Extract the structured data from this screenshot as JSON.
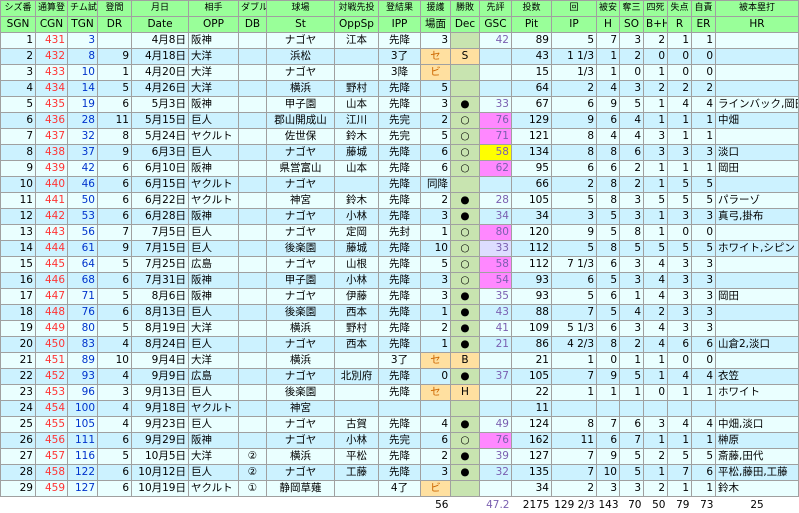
{
  "header1": [
    "シズ番",
    "通算登",
    "チム試",
    "登間",
    "月日",
    "相手",
    "ダブル",
    "球場",
    "対戦先投",
    "登結果",
    "援護",
    "勝敗",
    "先評",
    "投数",
    "回",
    "被安",
    "奪三",
    "四死",
    "失点",
    "自責",
    "被本塁打"
  ],
  "header2": [
    "SGN",
    "CGN",
    "TGN",
    "DR",
    "Date",
    "OPP",
    "DB",
    "St",
    "OppSp",
    "IPP",
    "場面",
    "Dec",
    "GSC",
    "Pit",
    "IP",
    "H",
    "SO",
    "B+H",
    "R",
    "ER",
    "HR"
  ],
  "rows": [
    {
      "sgn": "1",
      "cgn": "431",
      "tgn": "3",
      "dr": "",
      "date": "4月8日",
      "opp": "阪神",
      "db": "",
      "st": "ナゴヤ",
      "oppsp": "江本",
      "ipp": "先降",
      "sup": "3",
      "dec": "",
      "gsc": "42",
      "gscStyle": "",
      "pit": "89",
      "ip": "5",
      "h": "7",
      "so": "3",
      "bh": "2",
      "r": "1",
      "er": "1",
      "hr": ""
    },
    {
      "sgn": "2",
      "cgn": "432",
      "tgn": "8",
      "dr": "9",
      "date": "4月18日",
      "opp": "大洋",
      "db": "",
      "st": "浜松",
      "oppsp": "",
      "ipp": "3了",
      "sup": "セ",
      "dec": "S",
      "gsc": "",
      "gscStyle": "",
      "pit": "43",
      "ip": "1 1/3",
      "h": "1",
      "so": "2",
      "bh": "0",
      "r": "0",
      "er": "0",
      "hr": ""
    },
    {
      "sgn": "3",
      "cgn": "433",
      "tgn": "10",
      "dr": "1",
      "date": "4月20日",
      "opp": "大洋",
      "db": "",
      "st": "ナゴヤ",
      "oppsp": "",
      "ipp": "3降",
      "sup": "ビ",
      "dec": "",
      "gsc": "",
      "gscStyle": "",
      "pit": "15",
      "ip": "1/3",
      "h": "1",
      "so": "0",
      "bh": "1",
      "r": "0",
      "er": "0",
      "hr": ""
    },
    {
      "sgn": "4",
      "cgn": "434",
      "tgn": "14",
      "dr": "5",
      "date": "4月26日",
      "opp": "大洋",
      "db": "",
      "st": "横浜",
      "oppsp": "野村",
      "ipp": "先降",
      "sup": "5",
      "dec": "",
      "gsc": "",
      "gscStyle": "",
      "pit": "64",
      "ip": "2",
      "h": "4",
      "so": "3",
      "bh": "2",
      "r": "2",
      "er": "2",
      "hr": ""
    },
    {
      "sgn": "5",
      "cgn": "435",
      "tgn": "19",
      "dr": "6",
      "date": "5月3日",
      "opp": "阪神",
      "db": "",
      "st": "甲子園",
      "oppsp": "山本",
      "ipp": "先降",
      "sup": "3",
      "dec": "●",
      "gsc": "33",
      "gscStyle": "",
      "pit": "67",
      "ip": "6",
      "h": "9",
      "so": "5",
      "bh": "1",
      "r": "4",
      "er": "4",
      "hr": "ラインバック,岡田"
    },
    {
      "sgn": "6",
      "cgn": "436",
      "tgn": "28",
      "dr": "11",
      "date": "5月15日",
      "opp": "巨人",
      "db": "",
      "st": "郡山開成山",
      "oppsp": "江川",
      "ipp": "先完",
      "sup": "2",
      "dec": "○",
      "gsc": "76",
      "gscStyle": "g-hi",
      "pit": "129",
      "ip": "9",
      "h": "6",
      "so": "4",
      "bh": "1",
      "r": "1",
      "er": "1",
      "hr": "中畑"
    },
    {
      "sgn": "7",
      "cgn": "437",
      "tgn": "32",
      "dr": "8",
      "date": "5月24日",
      "opp": "ヤクルト",
      "db": "",
      "st": "佐世保",
      "oppsp": "鈴木",
      "ipp": "先完",
      "sup": "5",
      "dec": "○",
      "gsc": "71",
      "gscStyle": "g-hi",
      "pit": "121",
      "ip": "8",
      "h": "4",
      "so": "4",
      "bh": "3",
      "r": "1",
      "er": "1",
      "hr": ""
    },
    {
      "sgn": "8",
      "cgn": "438",
      "tgn": "37",
      "dr": "9",
      "date": "6月3日",
      "opp": "巨人",
      "db": "",
      "st": "ナゴヤ",
      "oppsp": "藤城",
      "ipp": "先降",
      "sup": "6",
      "dec": "○",
      "gsc": "58",
      "gscStyle": "g-top",
      "pit": "134",
      "ip": "8",
      "h": "8",
      "so": "6",
      "bh": "3",
      "r": "3",
      "er": "3",
      "hr": "淡口"
    },
    {
      "sgn": "9",
      "cgn": "439",
      "tgn": "42",
      "dr": "6",
      "date": "6月10日",
      "opp": "阪神",
      "db": "",
      "st": "県営富山",
      "oppsp": "山本",
      "ipp": "先降",
      "sup": "6",
      "dec": "○",
      "gsc": "62",
      "gscStyle": "g-hi",
      "pit": "95",
      "ip": "6",
      "h": "6",
      "so": "2",
      "bh": "1",
      "r": "1",
      "er": "1",
      "hr": "岡田"
    },
    {
      "sgn": "10",
      "cgn": "440",
      "tgn": "46",
      "dr": "6",
      "date": "6月15日",
      "opp": "ヤクルト",
      "db": "",
      "st": "ナゴヤ",
      "oppsp": "",
      "ipp": "先降",
      "sup": "同降",
      "dec": "",
      "gsc": "",
      "gscStyle": "",
      "pit": "66",
      "ip": "2",
      "h": "8",
      "so": "2",
      "bh": "1",
      "r": "5",
      "er": "5",
      "hr": ""
    },
    {
      "sgn": "11",
      "cgn": "441",
      "tgn": "50",
      "dr": "6",
      "date": "6月22日",
      "opp": "ヤクルト",
      "db": "",
      "st": "神宮",
      "oppsp": "鈴木",
      "ipp": "先降",
      "sup": "2",
      "dec": "●",
      "gsc": "28",
      "gscStyle": "",
      "pit": "105",
      "ip": "5",
      "h": "8",
      "so": "3",
      "bh": "5",
      "r": "5",
      "er": "5",
      "hr": "パラーゾ"
    },
    {
      "sgn": "12",
      "cgn": "442",
      "tgn": "53",
      "dr": "6",
      "date": "6月28日",
      "opp": "阪神",
      "db": "",
      "st": "ナゴヤ",
      "oppsp": "小林",
      "ipp": "先降",
      "sup": "3",
      "dec": "●",
      "gsc": "34",
      "gscStyle": "",
      "pit": "34",
      "ip": "3",
      "h": "5",
      "so": "3",
      "bh": "1",
      "r": "3",
      "er": "3",
      "hr": "真弓,掛布"
    },
    {
      "sgn": "13",
      "cgn": "443",
      "tgn": "56",
      "dr": "7",
      "date": "7月5日",
      "opp": "巨人",
      "db": "",
      "st": "ナゴヤ",
      "oppsp": "定岡",
      "ipp": "先封",
      "sup": "1",
      "dec": "○",
      "gsc": "80",
      "gscStyle": "g-hi",
      "pit": "120",
      "ip": "9",
      "h": "5",
      "so": "8",
      "bh": "1",
      "r": "0",
      "er": "0",
      "hr": ""
    },
    {
      "sgn": "14",
      "cgn": "444",
      "tgn": "61",
      "dr": "9",
      "date": "7月15日",
      "opp": "巨人",
      "db": "",
      "st": "後楽園",
      "oppsp": "藤城",
      "ipp": "先降",
      "sup": "10",
      "dec": "○",
      "gsc": "33",
      "gscStyle": "g-lo",
      "pit": "112",
      "ip": "5",
      "h": "8",
      "so": "5",
      "bh": "5",
      "r": "5",
      "er": "5",
      "hr": "ホワイト,シピン"
    },
    {
      "sgn": "15",
      "cgn": "445",
      "tgn": "64",
      "dr": "5",
      "date": "7月25日",
      "opp": "広島",
      "db": "",
      "st": "ナゴヤ",
      "oppsp": "山根",
      "ipp": "先降",
      "sup": "5",
      "dec": "○",
      "gsc": "58",
      "gscStyle": "g-hi",
      "pit": "112",
      "ip": "7 1/3",
      "h": "6",
      "so": "3",
      "bh": "4",
      "r": "3",
      "er": "3",
      "hr": ""
    },
    {
      "sgn": "16",
      "cgn": "446",
      "tgn": "68",
      "dr": "6",
      "date": "7月31日",
      "opp": "阪神",
      "db": "",
      "st": "甲子園",
      "oppsp": "小林",
      "ipp": "先降",
      "sup": "3",
      "dec": "○",
      "gsc": "54",
      "gscStyle": "g-hi",
      "pit": "93",
      "ip": "6",
      "h": "5",
      "so": "3",
      "bh": "4",
      "r": "3",
      "er": "3",
      "hr": ""
    },
    {
      "sgn": "17",
      "cgn": "447",
      "tgn": "71",
      "dr": "5",
      "date": "8月6日",
      "opp": "阪神",
      "db": "",
      "st": "ナゴヤ",
      "oppsp": "伊藤",
      "ipp": "先降",
      "sup": "3",
      "dec": "●",
      "gsc": "35",
      "gscStyle": "",
      "pit": "93",
      "ip": "5",
      "h": "6",
      "so": "1",
      "bh": "4",
      "r": "3",
      "er": "3",
      "hr": "岡田"
    },
    {
      "sgn": "18",
      "cgn": "448",
      "tgn": "76",
      "dr": "6",
      "date": "8月13日",
      "opp": "巨人",
      "db": "",
      "st": "後楽園",
      "oppsp": "西本",
      "ipp": "先降",
      "sup": "1",
      "dec": "●",
      "gsc": "43",
      "gscStyle": "",
      "pit": "88",
      "ip": "7",
      "h": "5",
      "so": "4",
      "bh": "2",
      "r": "3",
      "er": "3",
      "hr": ""
    },
    {
      "sgn": "19",
      "cgn": "449",
      "tgn": "80",
      "dr": "5",
      "date": "8月19日",
      "opp": "大洋",
      "db": "",
      "st": "横浜",
      "oppsp": "野村",
      "ipp": "先降",
      "sup": "2",
      "dec": "●",
      "gsc": "41",
      "gscStyle": "",
      "pit": "109",
      "ip": "5 1/3",
      "h": "6",
      "so": "3",
      "bh": "4",
      "r": "3",
      "er": "3",
      "hr": ""
    },
    {
      "sgn": "20",
      "cgn": "450",
      "tgn": "83",
      "dr": "4",
      "date": "8月24日",
      "opp": "巨人",
      "db": "",
      "st": "ナゴヤ",
      "oppsp": "西本",
      "ipp": "先降",
      "sup": "1",
      "dec": "●",
      "gsc": "21",
      "gscStyle": "",
      "pit": "86",
      "ip": "4 2/3",
      "h": "8",
      "so": "2",
      "bh": "4",
      "r": "6",
      "er": "6",
      "hr": "山倉2,淡口"
    },
    {
      "sgn": "21",
      "cgn": "451",
      "tgn": "89",
      "dr": "10",
      "date": "9月4日",
      "opp": "大洋",
      "db": "",
      "st": "横浜",
      "oppsp": "",
      "ipp": "3了",
      "sup": "セ",
      "dec": "B",
      "gsc": "",
      "gscStyle": "",
      "pit": "21",
      "ip": "1",
      "h": "0",
      "so": "1",
      "bh": "1",
      "r": "0",
      "er": "0",
      "hr": ""
    },
    {
      "sgn": "22",
      "cgn": "452",
      "tgn": "93",
      "dr": "4",
      "date": "9月9日",
      "opp": "広島",
      "db": "",
      "st": "ナゴヤ",
      "oppsp": "北別府",
      "ipp": "先降",
      "sup": "0",
      "dec": "●",
      "gsc": "37",
      "gscStyle": "",
      "pit": "105",
      "ip": "7",
      "h": "9",
      "so": "5",
      "bh": "1",
      "r": "4",
      "er": "4",
      "hr": "衣笠"
    },
    {
      "sgn": "23",
      "cgn": "453",
      "tgn": "96",
      "dr": "3",
      "date": "9月13日",
      "opp": "巨人",
      "db": "",
      "st": "後楽園",
      "oppsp": "",
      "ipp": "先降",
      "sup": "セ",
      "dec": "H",
      "gsc": "",
      "gscStyle": "",
      "pit": "22",
      "ip": "1",
      "h": "1",
      "so": "1",
      "bh": "0",
      "r": "1",
      "er": "1",
      "hr": "ホワイト"
    },
    {
      "sgn": "24",
      "cgn": "454",
      "tgn": "100",
      "dr": "4",
      "date": "9月18日",
      "opp": "ヤクルト",
      "db": "",
      "st": "神宮",
      "oppsp": "",
      "ipp": "",
      "sup": "",
      "dec": "",
      "gsc": "",
      "gscStyle": "",
      "pit": "11",
      "ip": "",
      "h": "",
      "so": "",
      "bh": "",
      "r": "",
      "er": "",
      "hr": ""
    },
    {
      "sgn": "25",
      "cgn": "455",
      "tgn": "105",
      "dr": "4",
      "date": "9月23日",
      "opp": "巨人",
      "db": "",
      "st": "ナゴヤ",
      "oppsp": "古賀",
      "ipp": "先降",
      "sup": "4",
      "dec": "●",
      "gsc": "49",
      "gscStyle": "",
      "pit": "124",
      "ip": "8",
      "h": "7",
      "so": "6",
      "bh": "3",
      "r": "4",
      "er": "4",
      "hr": "中畑,淡口"
    },
    {
      "sgn": "26",
      "cgn": "456",
      "tgn": "111",
      "dr": "6",
      "date": "9月29日",
      "opp": "阪神",
      "db": "",
      "st": "ナゴヤ",
      "oppsp": "小林",
      "ipp": "先完",
      "sup": "6",
      "dec": "○",
      "gsc": "76",
      "gscStyle": "g-hi",
      "pit": "162",
      "ip": "11",
      "h": "6",
      "so": "7",
      "bh": "1",
      "r": "1",
      "er": "1",
      "hr": "榊原"
    },
    {
      "sgn": "27",
      "cgn": "457",
      "tgn": "116",
      "dr": "5",
      "date": "10月5日",
      "opp": "大洋",
      "db": "②",
      "st": "横浜",
      "oppsp": "平松",
      "ipp": "先降",
      "sup": "2",
      "dec": "●",
      "gsc": "39",
      "gscStyle": "",
      "pit": "127",
      "ip": "7",
      "h": "9",
      "so": "5",
      "bh": "2",
      "r": "5",
      "er": "5",
      "hr": "斎藤,田代"
    },
    {
      "sgn": "28",
      "cgn": "458",
      "tgn": "122",
      "dr": "6",
      "date": "10月12日",
      "opp": "巨人",
      "db": "②",
      "st": "ナゴヤ",
      "oppsp": "工藤",
      "ipp": "先降",
      "sup": "3",
      "dec": "●",
      "gsc": "32",
      "gscStyle": "",
      "pit": "135",
      "ip": "7",
      "h": "10",
      "so": "5",
      "bh": "1",
      "r": "7",
      "er": "6",
      "hr": "平松,藤田,工藤"
    },
    {
      "sgn": "29",
      "cgn": "459",
      "tgn": "127",
      "dr": "6",
      "date": "10月19日",
      "opp": "ヤクルト",
      "db": "①",
      "st": "静岡草薙",
      "oppsp": "",
      "ipp": "4了",
      "sup": "ビ",
      "dec": "",
      "gsc": "",
      "gscStyle": "",
      "pit": "34",
      "ip": "2",
      "h": "3",
      "so": "3",
      "bh": "2",
      "r": "1",
      "er": "1",
      "hr": "鈴木"
    }
  ],
  "totals": {
    "sup": "56",
    "gsc": "47.2",
    "pit": "2175",
    "ip": "129 2/3",
    "h": "143",
    "so": "70",
    "bh": "50",
    "r": "79",
    "er": "73",
    "hr": "25"
  }
}
